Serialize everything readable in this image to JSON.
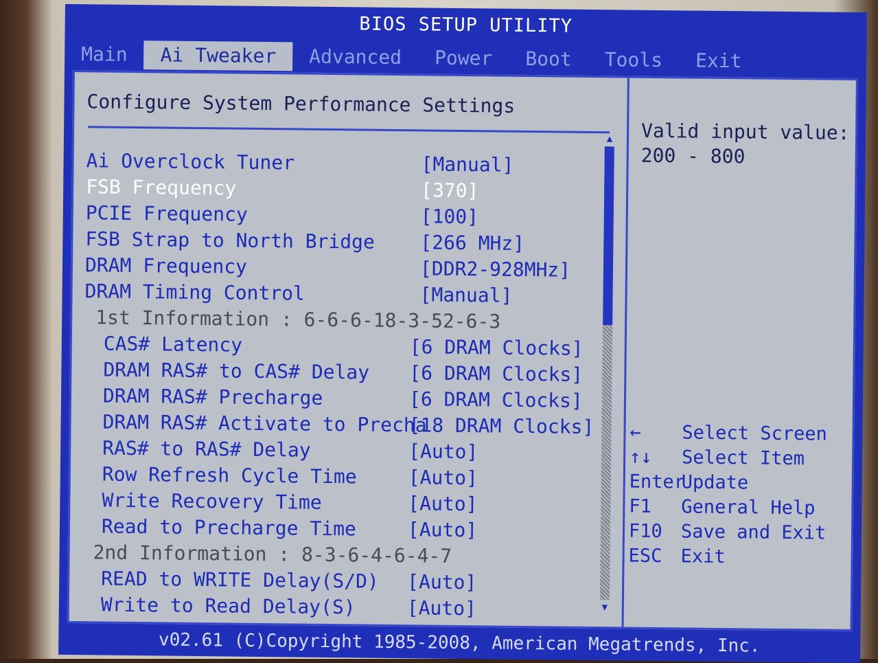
{
  "title": "BIOS SETUP UTILITY",
  "tabs": [
    {
      "label": "Main"
    },
    {
      "label": "Ai Tweaker"
    },
    {
      "label": "Advanced"
    },
    {
      "label": "Power"
    },
    {
      "label": "Boot"
    },
    {
      "label": "Tools"
    },
    {
      "label": "Exit"
    }
  ],
  "panel_title": "Configure System Performance Settings",
  "settings": [
    {
      "label": "Ai Overclock Tuner",
      "value": "[Manual]"
    },
    {
      "label": "FSB Frequency",
      "value": "[370]"
    },
    {
      "label": "PCIE Frequency",
      "value": "[100]"
    },
    {
      "label": "FSB Strap to North Bridge",
      "value": "[266 MHz]"
    },
    {
      "label": "DRAM Frequency",
      "value": "[DDR2-928MHz]"
    },
    {
      "label": "DRAM Timing Control",
      "value": "[Manual]"
    },
    {
      "label": "1st Information : 6-6-6-18-3-52-6-3",
      "value": ""
    },
    {
      "label": "CAS# Latency",
      "value": "[6 DRAM Clocks]"
    },
    {
      "label": "DRAM RAS# to CAS# Delay",
      "value": "[6 DRAM Clocks]"
    },
    {
      "label": "DRAM RAS# Precharge",
      "value": "[6 DRAM Clocks]"
    },
    {
      "label": "DRAM RAS# Activate to Precha",
      "value": "[18 DRAM Clocks]"
    },
    {
      "label": "RAS# to RAS# Delay",
      "value": "[Auto]"
    },
    {
      "label": "Row Refresh Cycle Time",
      "value": "[Auto]"
    },
    {
      "label": "Write Recovery Time",
      "value": "[Auto]"
    },
    {
      "label": "Read to Precharge Time",
      "value": "[Auto]"
    },
    {
      "label": "2nd Information : 8-3-6-4-6-4-7",
      "value": ""
    },
    {
      "label": "READ to WRITE Delay(S/D)",
      "value": "[Auto]"
    },
    {
      "label": "Write to Read Delay(S)",
      "value": "[Auto]"
    }
  ],
  "help": {
    "line1": "Valid input value:",
    "line2": "200 - 800"
  },
  "keys": [
    {
      "key": "←",
      "desc": "Select Screen"
    },
    {
      "key": "↑↓",
      "desc": "Select Item"
    },
    {
      "key": "Enter",
      "desc": "Update"
    },
    {
      "key": "F1",
      "desc": "General Help"
    },
    {
      "key": "F10",
      "desc": "Save and Exit"
    },
    {
      "key": "ESC",
      "desc": "Exit"
    }
  ],
  "footer": "v02.61 (C)Copyright 1985-2008, American Megatrends, Inc."
}
